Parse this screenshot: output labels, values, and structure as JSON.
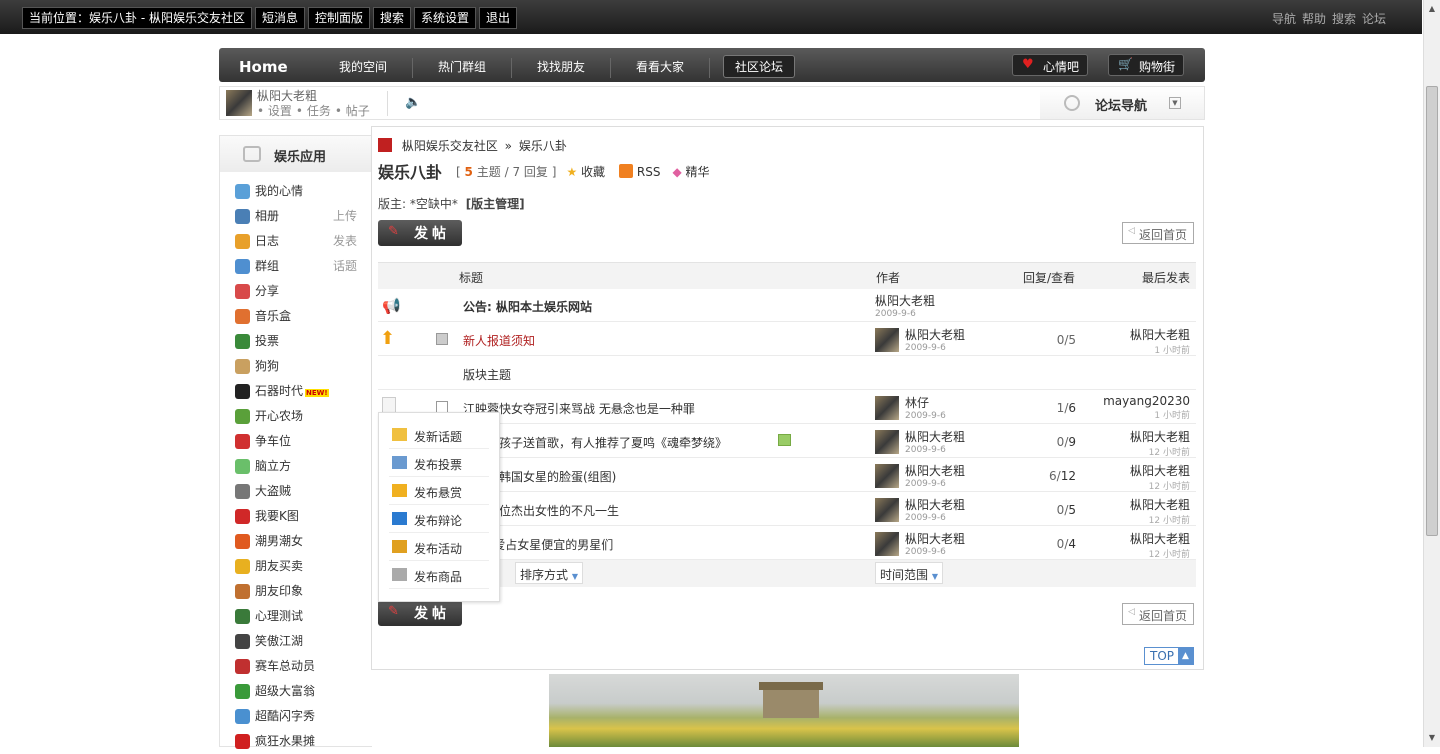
{
  "topbar": {
    "location_label": "当前位置：娱乐八卦 - 枞阳娱乐交友社区",
    "buttons": [
      "短消息",
      "控制面版",
      "搜索",
      "系统设置",
      "退出"
    ],
    "right_links": [
      "导航",
      "帮助",
      "搜索",
      "论坛"
    ]
  },
  "nav": {
    "home": "Home",
    "links": [
      "我的空间",
      "热门群组",
      "找找朋友",
      "看看大家"
    ],
    "active": "社区论坛",
    "mood_button": "心情吧",
    "shop_button": "购物街"
  },
  "userbar": {
    "username": "枞阳大老粗",
    "links": [
      "设置",
      "任务",
      "帖子"
    ],
    "forum_nav": "论坛导航"
  },
  "sidebar": {
    "title": "娱乐应用",
    "items": [
      {
        "label": "我的心情",
        "extra": "",
        "color": "#5aa0d8"
      },
      {
        "label": "相册",
        "extra": "上传",
        "color": "#4a7fb5"
      },
      {
        "label": "日志",
        "extra": "发表",
        "color": "#e8a02a"
      },
      {
        "label": "群组",
        "extra": "话题",
        "color": "#4f8fd0"
      },
      {
        "label": "分享",
        "extra": "",
        "color": "#d84a4a"
      },
      {
        "label": "音乐盒",
        "extra": "",
        "color": "#e07030"
      },
      {
        "label": "投票",
        "extra": "",
        "color": "#3a8a3a"
      },
      {
        "label": "狗狗",
        "extra": "",
        "color": "#c9a060"
      },
      {
        "label": "石器时代",
        "extra": "",
        "color": "#222222",
        "badge": "NEW!"
      },
      {
        "label": "开心农场",
        "extra": "",
        "color": "#5aa03a"
      },
      {
        "label": "争车位",
        "extra": "",
        "color": "#d03030"
      },
      {
        "label": "脑立方",
        "extra": "",
        "color": "#6abf6a"
      },
      {
        "label": "大盗贼",
        "extra": "",
        "color": "#777777"
      },
      {
        "label": "我要K图",
        "extra": "",
        "color": "#d02828"
      },
      {
        "label": "潮男潮女",
        "extra": "",
        "color": "#e05a20"
      },
      {
        "label": "朋友买卖",
        "extra": "",
        "color": "#e8b020"
      },
      {
        "label": "朋友印象",
        "extra": "",
        "color": "#c07030"
      },
      {
        "label": "心理测试",
        "extra": "",
        "color": "#3a7a3a"
      },
      {
        "label": "笑傲江湖",
        "extra": "",
        "color": "#444444"
      },
      {
        "label": "赛车总动员",
        "extra": "",
        "color": "#c03030"
      },
      {
        "label": "超级大富翁",
        "extra": "",
        "color": "#3a9a3a"
      },
      {
        "label": "超酷闪字秀",
        "extra": "",
        "color": "#4a90d0"
      },
      {
        "label": "疯狂水果摊",
        "extra": "",
        "color": "#d02020"
      }
    ]
  },
  "forum": {
    "breadcrumb_root": "枞阳娱乐交友社区",
    "breadcrumb_sep": "»",
    "breadcrumb_current": "娱乐八卦",
    "title": "娱乐八卦",
    "stats_prefix": "[",
    "topics_num": "5",
    "topics_label": "主题",
    "stats_sep": "/",
    "replies_num": "7",
    "replies_label": "回复",
    "stats_suffix": "]",
    "favorite": "收藏",
    "rss": "RSS",
    "digest": "精华",
    "moderator_label": "版主: *空缺中*",
    "moderator_manage": "[版主管理]",
    "post_button": "发帖",
    "back_home": "返回首页",
    "top_button": "TOP"
  },
  "table": {
    "headers": {
      "title": "标题",
      "author": "作者",
      "counts": "回复/查看",
      "last": "最后发表"
    },
    "announcement": {
      "title": "公告: 枞阳本土娱乐网站",
      "author": "枞阳大老粗",
      "date": "2009-9-6"
    },
    "sticky": {
      "title": "新人报道须知",
      "author": "枞阳大老粗",
      "date": "2009-9-6",
      "counts": "0/5",
      "last_author": "枞阳大老粗",
      "last_time": "1 小时前"
    },
    "section_label": "版块主题",
    "rows": [
      {
        "title": "江映蓉快女夺冠引来骂战 无悬念也是一种罪",
        "author": "林仔",
        "date": "2009-9-6",
        "replies": "1",
        "views": "6",
        "last_author": "mayang20230",
        "last_time": "1 小时前"
      },
      {
        "title": "欢的女孩子送首歌，有人推荐了夏鸣《魂牵梦绕》",
        "author": "枞阳大老粗",
        "date": "2009-9-6",
        "replies": "0",
        "views": "9",
        "last_author": "枞阳大老粗",
        "last_time": "12 小时前"
      },
      {
        "title": "离观察韩国女星的脸蛋(组图)",
        "author": "枞阳大老粗",
        "date": "2009-9-6",
        "replies": "6",
        "views": "12",
        "last_author": "枞阳大老粗",
        "last_time": "12 小时前"
      },
      {
        "title": "撼的十位杰出女性的不凡一生",
        "author": "枞阳大老粗",
        "date": "2009-9-6",
        "replies": "0",
        "views": "5",
        "last_author": "枞阳大老粗",
        "last_time": "12 小时前"
      },
      {
        "title": "戏”最爱占女星便宜的男星们",
        "author": "枞阳大老粗",
        "date": "2009-9-6",
        "replies": "0",
        "views": "4",
        "last_author": "枞阳大老粗",
        "last_time": "12 小时前"
      }
    ],
    "sort_label": "排序方式",
    "time_label": "时间范围"
  },
  "popup": {
    "items": [
      "发新话题",
      "发布投票",
      "发布悬赏",
      "发布辩论",
      "发布活动",
      "发布商品"
    ]
  }
}
